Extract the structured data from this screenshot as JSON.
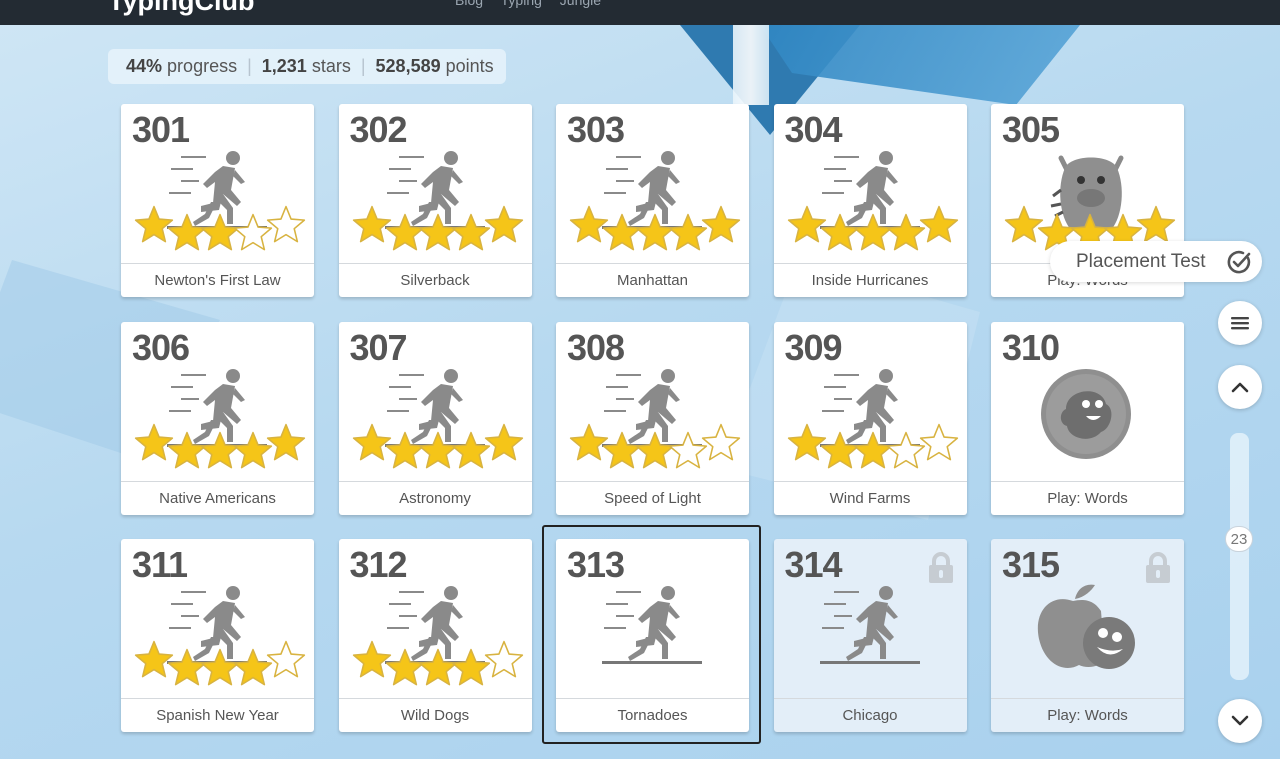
{
  "app": {
    "logo": "TypingClub",
    "nav": "Blog   Typing Jungle"
  },
  "stats": {
    "progress": "44%",
    "progress_label": "progress",
    "stars": "1,231",
    "stars_label": "stars",
    "points": "528,589",
    "points_label": "points"
  },
  "lessons": [
    {
      "num": "301",
      "title": "Newton's First Law",
      "stars": 3
    },
    {
      "num": "302",
      "title": "Silverback",
      "stars": 5
    },
    {
      "num": "303",
      "title": "Manhattan",
      "stars": 5
    },
    {
      "num": "304",
      "title": "Inside Hurricanes",
      "stars": 5
    },
    {
      "num": "305",
      "title": "Play: Words",
      "stars": 5,
      "type": "game"
    },
    {
      "num": "306",
      "title": "Native Americans",
      "stars": 5
    },
    {
      "num": "307",
      "title": "Astronomy",
      "stars": 5
    },
    {
      "num": "308",
      "title": "Speed of Light",
      "stars": 3
    },
    {
      "num": "309",
      "title": "Wind Farms",
      "stars": 3
    },
    {
      "num": "310",
      "title": "Play: Words",
      "stars": 0,
      "type": "game"
    },
    {
      "num": "311",
      "title": "Spanish New Year",
      "stars": 4
    },
    {
      "num": "312",
      "title": "Wild Dogs",
      "stars": 4
    },
    {
      "num": "313",
      "title": "Tornadoes",
      "stars": 0,
      "selected": true
    },
    {
      "num": "314",
      "title": "Chicago",
      "stars": 0,
      "locked": true
    },
    {
      "num": "315",
      "title": "Play: Words",
      "stars": 0,
      "locked": true,
      "type": "game"
    }
  ],
  "placement_test": "Placement Test",
  "page_indicator": "23",
  "icons": {
    "menu": "menu-icon",
    "up": "chevron-up-icon",
    "down": "chevron-down-icon",
    "check": "check-circle-icon",
    "lock": "lock-icon"
  },
  "colors": {
    "star_fill": "#f5c518",
    "star_outline": "#d8b340",
    "figure": "#8a8a8a",
    "topbar": "#232b33"
  }
}
